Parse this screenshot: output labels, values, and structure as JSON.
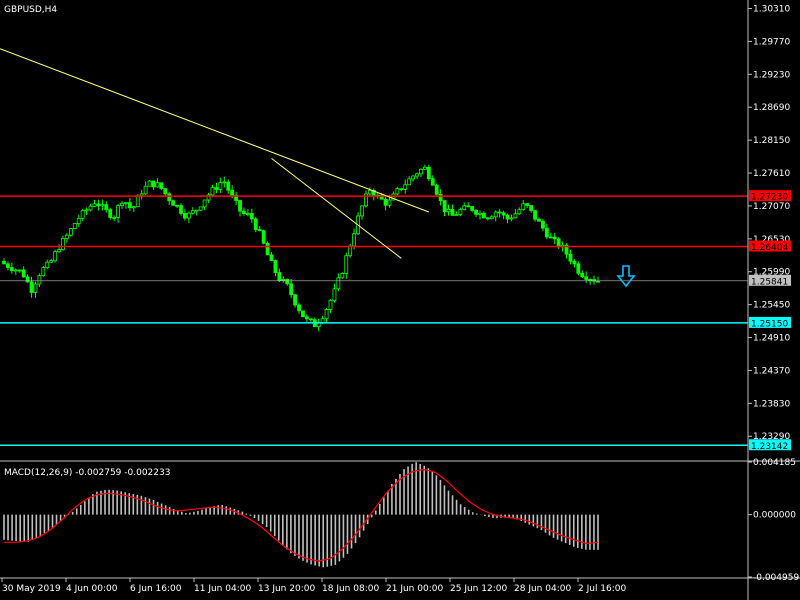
{
  "chart_data": [
    {
      "type": "candlestick",
      "title": "GBPUSD,H4",
      "y_ticks": [
        "1.30310",
        "1.29770",
        "1.29230",
        "1.28690",
        "1.28150",
        "1.27610",
        "1.27070",
        "1.26530",
        "1.25990",
        "1.25450",
        "1.24910",
        "1.24370",
        "1.23830",
        "1.23290"
      ],
      "ylim": [
        1.229,
        1.3045
      ],
      "x_ticks": [
        "30 May 2019",
        "4 Jun 00:00",
        "6 Jun 16:00",
        "11 Jun 04:00",
        "13 Jun 20:00",
        "18 Jun 08:00",
        "21 Jun 00:00",
        "25 Jun 12:00",
        "28 Jun 04:00",
        "2 Jul 16:00"
      ],
      "close_path": [
        1.2612,
        1.2605,
        1.2598,
        1.257,
        1.26,
        1.2612,
        1.264,
        1.266,
        1.2685,
        1.27,
        1.2715,
        1.27,
        1.269,
        1.272,
        1.27,
        1.273,
        1.2745,
        1.274,
        1.272,
        1.2705,
        1.269,
        1.27,
        1.272,
        1.2735,
        1.275,
        1.272,
        1.2695,
        1.269,
        1.266,
        1.262,
        1.259,
        1.2575,
        1.2545,
        1.252,
        1.2512,
        1.253,
        1.256,
        1.26,
        1.265,
        1.27,
        1.2735,
        1.272,
        1.271,
        1.273,
        1.2745,
        1.276,
        1.277,
        1.2745,
        1.2705,
        1.269,
        1.27,
        1.2705,
        1.2695,
        1.269,
        1.27,
        1.2685,
        1.2695,
        1.271,
        1.269,
        1.267,
        1.265,
        1.264,
        1.262,
        1.2598,
        1.259,
        1.2584
      ],
      "price_levels": [
        {
          "label": "1.27230",
          "value": 1.2723,
          "color": "#ff0000"
        },
        {
          "label": "1.26404",
          "value": 1.26404,
          "color": "#ff0000"
        },
        {
          "label": "1.25841",
          "value": 1.25841,
          "color": "#c0c0c0"
        },
        {
          "label": "1.25150",
          "value": 1.2515,
          "color": "#00ffff"
        },
        {
          "label": "1.23142",
          "value": 1.23142,
          "color": "#00ffff"
        }
      ],
      "trendlines": [
        {
          "color": "#ffff80",
          "from": {
            "bar": -1,
            "price": 1.2965
          },
          "to": {
            "bar": 108,
            "price": 1.2697
          }
        },
        {
          "color": "#ffff80",
          "from": {
            "bar": 68,
            "price": 1.2785
          },
          "to": {
            "bar": 101,
            "price": 1.2621
          }
        }
      ],
      "signal_arrow": {
        "direction": "down",
        "color": "#00bfff"
      }
    },
    {
      "type": "histogram",
      "title": "MACD(12,26,9) -0.002759 -0.002233",
      "y_ticks": [
        "0.004185",
        "0.000000",
        "-0.004959"
      ],
      "ylim": [
        -0.004959,
        0.004185
      ],
      "histogram_color": "#c0c0c0",
      "signal_color": "#ff0000",
      "macd_path": [
        -0.002,
        -0.0021,
        -0.0022,
        -0.0018,
        -0.0012,
        -0.0005,
        0.0002,
        0.001,
        0.0018,
        0.002,
        0.0019,
        0.0017,
        0.0015,
        0.0012,
        0.0008,
        0.0004,
        0.0001,
        0.0003,
        0.0006,
        0.0008,
        0.0005,
        0.0002,
        -0.0003,
        -0.001,
        -0.002,
        -0.003,
        -0.0036,
        -0.004,
        -0.0042,
        -0.004,
        -0.0032,
        -0.002,
        -0.0005,
        0.001,
        0.0025,
        0.0036,
        0.0042,
        0.0038,
        0.003,
        0.0018,
        0.0008,
        0.0002,
        -0.0001,
        -0.0003,
        -0.0002,
        -0.0004,
        -0.0008,
        -0.0012,
        -0.0018,
        -0.0022,
        -0.0026,
        -0.0028,
        -0.0028
      ],
      "signal_path": [
        -0.0022,
        -0.0022,
        -0.0021,
        -0.0018,
        -0.0012,
        -0.0004,
        0.0005,
        0.0012,
        0.0016,
        0.0017,
        0.0016,
        0.0014,
        0.0011,
        0.0007,
        0.0004,
        0.0003,
        0.0004,
        0.0005,
        0.0006,
        0.0005,
        0.0002,
        -0.0003,
        -0.0009,
        -0.0017,
        -0.0025,
        -0.0031,
        -0.0035,
        -0.0037,
        -0.0035,
        -0.0028,
        -0.0018,
        -0.0006,
        0.0007,
        0.0019,
        0.0028,
        0.0034,
        0.0036,
        0.0034,
        0.0027,
        0.0018,
        0.001,
        0.0004,
        0.0,
        -0.0002,
        -0.0003,
        -0.0005,
        -0.0009,
        -0.0013,
        -0.0017,
        -0.002,
        -0.0023,
        -0.0022
      ]
    }
  ]
}
